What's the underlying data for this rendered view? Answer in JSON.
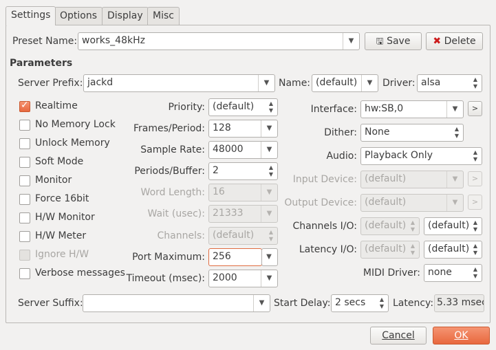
{
  "tabs": [
    "Settings",
    "Options",
    "Display",
    "Misc"
  ],
  "preset": {
    "label": "Preset Name:",
    "value": "works_48kHz",
    "save": "Save",
    "delete": "Delete"
  },
  "parameters_heading": "Parameters",
  "server_prefix": {
    "label": "Server Prefix:",
    "value": "jackd"
  },
  "name": {
    "label": "Name:",
    "value": "(default)"
  },
  "driver": {
    "label": "Driver:",
    "value": "alsa"
  },
  "checkboxes": [
    {
      "label": "Realtime",
      "checked": true,
      "enabled": true
    },
    {
      "label": "No Memory Lock",
      "checked": false,
      "enabled": true
    },
    {
      "label": "Unlock Memory",
      "checked": false,
      "enabled": true
    },
    {
      "label": "Soft Mode",
      "checked": false,
      "enabled": true
    },
    {
      "label": "Monitor",
      "checked": false,
      "enabled": true
    },
    {
      "label": "Force 16bit",
      "checked": false,
      "enabled": true
    },
    {
      "label": "H/W Monitor",
      "checked": false,
      "enabled": true
    },
    {
      "label": "H/W Meter",
      "checked": false,
      "enabled": true
    },
    {
      "label": "Ignore H/W",
      "checked": false,
      "enabled": false
    },
    {
      "label": "Verbose messages",
      "checked": false,
      "enabled": true
    }
  ],
  "mid": {
    "priority": {
      "label": "Priority:",
      "value": "(default)"
    },
    "frames": {
      "label": "Frames/Period:",
      "value": "128"
    },
    "sample_rate": {
      "label": "Sample Rate:",
      "value": "48000"
    },
    "periods": {
      "label": "Periods/Buffer:",
      "value": "2"
    },
    "word_length": {
      "label": "Word Length:",
      "value": "16"
    },
    "wait": {
      "label": "Wait (usec):",
      "value": "21333"
    },
    "channels": {
      "label": "Channels:",
      "value": "(default)"
    },
    "port_max": {
      "label": "Port Maximum:",
      "value": "256"
    },
    "timeout": {
      "label": "Timeout (msec):",
      "value": "2000"
    }
  },
  "right": {
    "interface": {
      "label": "Interface:",
      "value": "hw:SB,0"
    },
    "dither": {
      "label": "Dither:",
      "value": "None"
    },
    "audio": {
      "label": "Audio:",
      "value": "Playback Only"
    },
    "input_device": {
      "label": "Input Device:",
      "value": "(default)"
    },
    "output_device": {
      "label": "Output Device:",
      "value": "(default)"
    },
    "channels_io": {
      "label": "Channels I/O:",
      "in": "(default)",
      "out": "(default)"
    },
    "latency_io": {
      "label": "Latency I/O:",
      "in": "(default)",
      "out": "(default)"
    },
    "midi": {
      "label": "MIDI Driver:",
      "value": "none"
    }
  },
  "bottom": {
    "server_suffix": {
      "label": "Server Suffix:",
      "value": ""
    },
    "start_delay": {
      "label": "Start Delay:",
      "value": "2 secs"
    },
    "latency": {
      "label": "Latency:",
      "value": "5.33 msec"
    }
  },
  "buttons": {
    "cancel": "Cancel",
    "ok": "OK"
  },
  "icons": {
    "save": "floppy-disk-icon",
    "delete": "red-x-icon",
    "more": "arrow-right-icon"
  },
  "colors": {
    "accent": "#e8683e"
  }
}
